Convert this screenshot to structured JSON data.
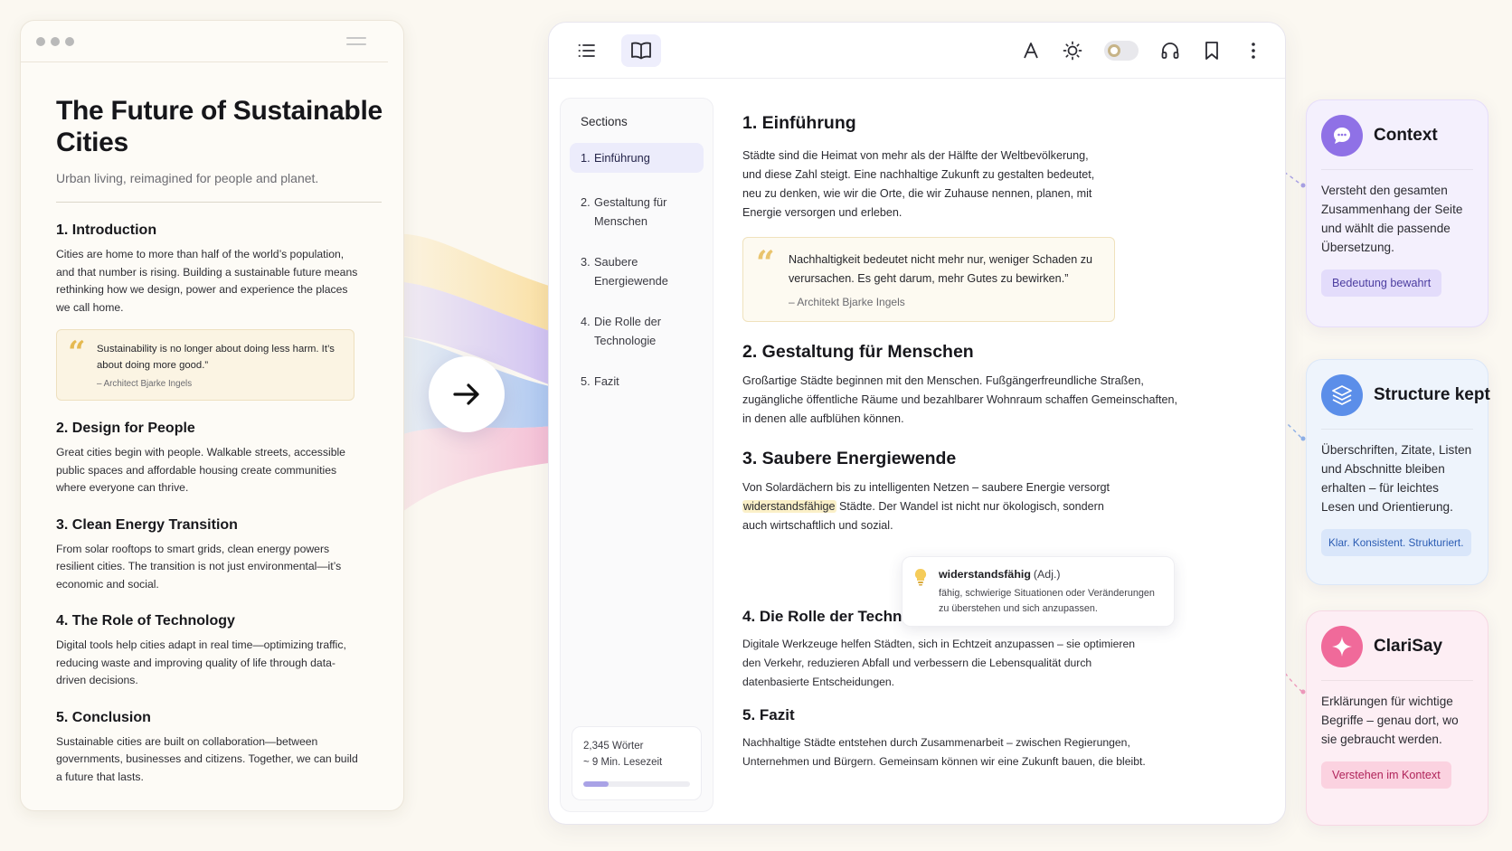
{
  "source_page": {
    "title": "The Future of Sustainable Cities",
    "subtitle": "Urban living, reimagined for people and planet.",
    "sections": [
      {
        "heading": "1. Introduction",
        "text": "Cities are home to more than half of the world’s population, and that number is rising. Building a sustainable future means rethinking how we design, power and experience the places we call home."
      },
      {
        "heading": "2. Design for People",
        "text": "Great cities begin with people. Walkable streets, accessible public spaces and affordable housing create communities where everyone can thrive."
      },
      {
        "heading": "3. Clean Energy Transition",
        "text": "From solar rooftops to smart grids, clean energy powers resilient cities. The transition is not just environmental—it’s economic and social."
      },
      {
        "heading": "4. The Role of Technology",
        "text": "Digital tools help cities adapt in real time—optimizing traffic, reducing waste and improving quality of life through data-driven decisions."
      },
      {
        "heading": "5. Conclusion",
        "text": "Sustainable cities are built on collaboration—between governments, businesses and citizens. Together, we can build a future that lasts."
      }
    ],
    "quote": {
      "mark": "“",
      "text": "Sustainability is no longer about doing less harm. It’s about doing more good.”",
      "author": "– Architect Bjarke Ingels"
    }
  },
  "reader": {
    "sections_title": "Sections",
    "nav": [
      {
        "num": "1.",
        "label": "Einführung",
        "active": true
      },
      {
        "num": "2.",
        "label": "Gestaltung für Menschen",
        "active": false
      },
      {
        "num": "3.",
        "label": "Saubere Energiewende",
        "active": false
      },
      {
        "num": "4.",
        "label": "Die Rolle der Technologie",
        "active": false
      },
      {
        "num": "5.",
        "label": "Fazit",
        "active": false
      }
    ],
    "stats": {
      "words": "2,345 Wörter",
      "read_time": "~ 9 Min. Lesezeit",
      "progress": 0.24
    },
    "content": {
      "s1": {
        "heading": "1. Einführung",
        "text": "Städte sind die Heimat von mehr als der Hälfte der Weltbevölkerung, und diese Zahl steigt. Eine nachhaltige Zukunft zu gestalten bedeutet, neu zu denken, wie wir die Orte, die wir Zuhause nennen, planen, mit Energie versorgen und erleben."
      },
      "quote": {
        "mark": "“",
        "text": "Nachhaltigkeit bedeutet nicht mehr nur, weniger Schaden zu verursachen. Es geht darum, mehr Gutes zu bewirken.”",
        "author": "– Architekt Bjarke Ingels"
      },
      "s2": {
        "heading": "2. Gestaltung für Menschen",
        "text": "Großartige Städte beginnen mit den Menschen. Fußgängerfreundliche Straßen, zugängliche öffentliche Räume und bezahlbarer Wohnraum schaffen Gemeinschaften, in denen alle aufblühen können."
      },
      "s3": {
        "heading": "3. Saubere Energiewende",
        "text_before": "Von Solardächern bis zu intelligenten Netzen – saubere Energie versorgt ",
        "highlight": "widerstandsfähige",
        "text_after": " Städte. Der Wandel ist nicht nur ökologisch, sondern auch wirtschaftlich und sozial."
      },
      "tooltip": {
        "word": "widerstandsfähig",
        "pos": "(Adj.)",
        "definition": "fähig, schwierige Situationen oder Veränderungen zu überstehen und sich anzupassen."
      },
      "s4": {
        "heading": "4. Die Rolle der Technologie",
        "text": "Digitale Werkzeuge helfen Städten, sich in Echtzeit anzupassen – sie optimieren den Verkehr, reduzieren Abfall und verbessern die Lebensqualität durch datenbasierte Entscheidungen."
      },
      "s5": {
        "heading": "5. Fazit",
        "text": "Nachhaltige Städte entstehen durch Zusammenarbeit – zwischen Regierungen, Unternehmen und Bürgern. Gemeinsam können wir eine Zukunft bauen, die bleibt."
      }
    },
    "toolbar_icons": [
      "list-icon",
      "book-icon",
      "font-size-icon",
      "brightness-icon",
      "theme-toggle",
      "headphones-icon",
      "bookmark-icon",
      "more-icon"
    ]
  },
  "cards": [
    {
      "title": "Context",
      "text": "Versteht den gesamten Zusammenhang der Seite und wählt die passende Übersetzung.",
      "chip": "Bedeutung bewahrt",
      "icon": "chat-bubble-icon"
    },
    {
      "title": "Structure kept",
      "text": "Überschriften, Zitate, Listen und Abschnitte bleiben erhalten – für leichtes Lesen und Orientierung.",
      "chip": "Klar. Konsistent. Strukturiert.",
      "icon": "layers-icon"
    },
    {
      "title": "ClariSay",
      "text": "Erklärungen für wichtige Begriffe – genau dort, wo sie gebraucht werden.",
      "chip": "Verstehen im Kontext",
      "icon": "sparkle-icon"
    }
  ],
  "colors": {
    "accent": "#8f71e6",
    "structure": "#5b8ee9",
    "clarisay": "#f06a9a",
    "highlight": "#fbf0c8",
    "quote_mark": "#e9c46d"
  }
}
